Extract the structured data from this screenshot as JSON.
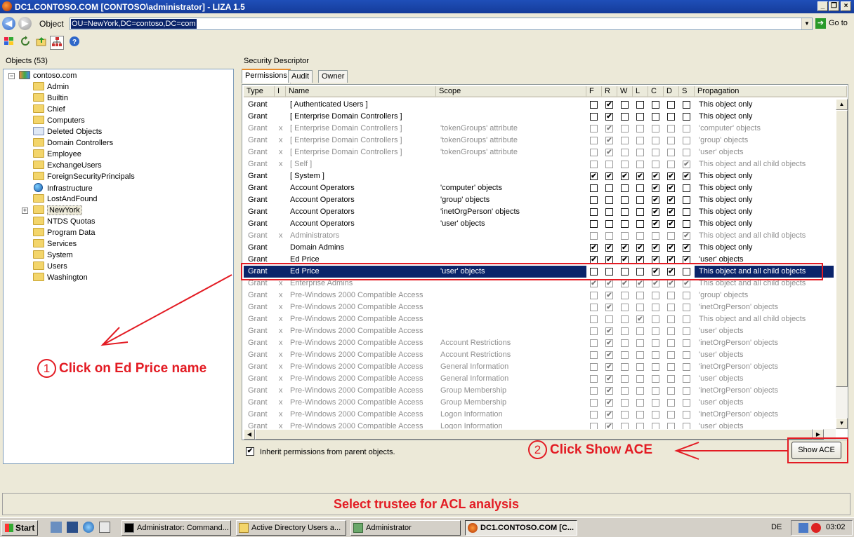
{
  "window": {
    "title": "DC1.CONTOSO.COM [CONTOSO\\administrator] - LIZA 1.5"
  },
  "address": {
    "label": "Object",
    "value": "OU=NewYork,DC=contoso,DC=com",
    "go_label": "Go to"
  },
  "toolbar": {
    "icons": [
      "windows-logo-icon",
      "refresh-icon",
      "export-icon",
      "tree-view-icon",
      "help-icon"
    ]
  },
  "objects_panel": {
    "label": "Objects (53)",
    "root": "contoso.com",
    "items": [
      "Admin",
      "Builtin",
      "Chief",
      "Computers",
      "Deleted Objects",
      "Domain Controllers",
      "Employee",
      "ExchangeUsers",
      "ForeignSecurityPrincipals",
      "Infrastructure",
      "LostAndFound",
      "NewYork",
      "NTDS Quotas",
      "Program Data",
      "Services",
      "System",
      "Users",
      "Washington"
    ],
    "selected": "NewYork"
  },
  "security": {
    "label": "Security Descriptor",
    "tabs": [
      "Permissions",
      "Audit",
      "Owner"
    ],
    "active_tab": "Permissions",
    "columns": [
      "Type",
      "I",
      "Name",
      "Scope",
      "F",
      "R",
      "W",
      "L",
      "C",
      "D",
      "S",
      "Propagation"
    ],
    "rows": [
      {
        "type": "Grant",
        "i": "",
        "name": "[ Authenticated Users ]",
        "scope": "",
        "perms": [
          0,
          1,
          0,
          0,
          0,
          0,
          0
        ],
        "prop": "This object only",
        "inherited": false
      },
      {
        "type": "Grant",
        "i": "",
        "name": "[ Enterprise Domain Controllers ]",
        "scope": "",
        "perms": [
          0,
          1,
          0,
          0,
          0,
          0,
          0
        ],
        "prop": "This object only",
        "inherited": false
      },
      {
        "type": "Grant",
        "i": "x",
        "name": "[ Enterprise Domain Controllers ]",
        "scope": "'tokenGroups' attribute",
        "perms": [
          0,
          1,
          0,
          0,
          0,
          0,
          0
        ],
        "prop": "'computer' objects",
        "inherited": true
      },
      {
        "type": "Grant",
        "i": "x",
        "name": "[ Enterprise Domain Controllers ]",
        "scope": "'tokenGroups' attribute",
        "perms": [
          0,
          1,
          0,
          0,
          0,
          0,
          0
        ],
        "prop": "'group' objects",
        "inherited": true
      },
      {
        "type": "Grant",
        "i": "x",
        "name": "[ Enterprise Domain Controllers ]",
        "scope": "'tokenGroups' attribute",
        "perms": [
          0,
          1,
          0,
          0,
          0,
          0,
          0
        ],
        "prop": "'user' objects",
        "inherited": true
      },
      {
        "type": "Grant",
        "i": "x",
        "name": "[ Self ]",
        "scope": "",
        "perms": [
          0,
          0,
          0,
          0,
          0,
          0,
          1
        ],
        "prop": "This object and all child objects",
        "inherited": true
      },
      {
        "type": "Grant",
        "i": "",
        "name": "[ System ]",
        "scope": "",
        "perms": [
          1,
          1,
          1,
          1,
          1,
          1,
          1
        ],
        "prop": "This object only",
        "inherited": false
      },
      {
        "type": "Grant",
        "i": "",
        "name": "Account Operators",
        "scope": "'computer' objects",
        "perms": [
          0,
          0,
          0,
          0,
          1,
          1,
          0
        ],
        "prop": "This object only",
        "inherited": false
      },
      {
        "type": "Grant",
        "i": "",
        "name": "Account Operators",
        "scope": "'group' objects",
        "perms": [
          0,
          0,
          0,
          0,
          1,
          1,
          0
        ],
        "prop": "This object only",
        "inherited": false
      },
      {
        "type": "Grant",
        "i": "",
        "name": "Account Operators",
        "scope": "'inetOrgPerson' objects",
        "perms": [
          0,
          0,
          0,
          0,
          1,
          1,
          0
        ],
        "prop": "This object only",
        "inherited": false
      },
      {
        "type": "Grant",
        "i": "",
        "name": "Account Operators",
        "scope": "'user' objects",
        "perms": [
          0,
          0,
          0,
          0,
          1,
          1,
          0
        ],
        "prop": "This object only",
        "inherited": false
      },
      {
        "type": "Grant",
        "i": "x",
        "name": "Administrators",
        "scope": "",
        "perms": [
          0,
          0,
          0,
          0,
          0,
          0,
          1
        ],
        "prop": "This object and all child objects",
        "inherited": true
      },
      {
        "type": "Grant",
        "i": "",
        "name": "Domain Admins",
        "scope": "",
        "perms": [
          1,
          1,
          1,
          1,
          1,
          1,
          1
        ],
        "prop": "This object only",
        "inherited": false
      },
      {
        "type": "Grant",
        "i": "",
        "name": "Ed Price",
        "scope": "",
        "perms": [
          1,
          1,
          1,
          1,
          1,
          1,
          1
        ],
        "prop": "'user' objects",
        "inherited": false
      },
      {
        "type": "Grant",
        "i": "",
        "name": "Ed Price",
        "scope": "'user' objects",
        "perms": [
          0,
          0,
          0,
          0,
          1,
          1,
          0
        ],
        "prop": "This object and all child objects",
        "inherited": false,
        "selected": true
      },
      {
        "type": "Grant",
        "i": "x",
        "name": "Enterprise Admins",
        "scope": "",
        "perms": [
          1,
          1,
          1,
          1,
          1,
          1,
          1
        ],
        "prop": "This object and all child objects",
        "inherited": true
      },
      {
        "type": "Grant",
        "i": "x",
        "name": "Pre-Windows 2000 Compatible Access",
        "scope": "",
        "perms": [
          0,
          1,
          0,
          0,
          0,
          0,
          0
        ],
        "prop": "'group' objects",
        "inherited": true
      },
      {
        "type": "Grant",
        "i": "x",
        "name": "Pre-Windows 2000 Compatible Access",
        "scope": "",
        "perms": [
          0,
          1,
          0,
          0,
          0,
          0,
          0
        ],
        "prop": "'inetOrgPerson' objects",
        "inherited": true
      },
      {
        "type": "Grant",
        "i": "x",
        "name": "Pre-Windows 2000 Compatible Access",
        "scope": "",
        "perms": [
          0,
          0,
          0,
          1,
          0,
          0,
          0
        ],
        "prop": "This object and all child objects",
        "inherited": true
      },
      {
        "type": "Grant",
        "i": "x",
        "name": "Pre-Windows 2000 Compatible Access",
        "scope": "",
        "perms": [
          0,
          1,
          0,
          0,
          0,
          0,
          0
        ],
        "prop": "'user' objects",
        "inherited": true
      },
      {
        "type": "Grant",
        "i": "x",
        "name": "Pre-Windows 2000 Compatible Access",
        "scope": "Account Restrictions",
        "perms": [
          0,
          1,
          0,
          0,
          0,
          0,
          0
        ],
        "prop": "'inetOrgPerson' objects",
        "inherited": true
      },
      {
        "type": "Grant",
        "i": "x",
        "name": "Pre-Windows 2000 Compatible Access",
        "scope": "Account Restrictions",
        "perms": [
          0,
          1,
          0,
          0,
          0,
          0,
          0
        ],
        "prop": "'user' objects",
        "inherited": true
      },
      {
        "type": "Grant",
        "i": "x",
        "name": "Pre-Windows 2000 Compatible Access",
        "scope": "General Information",
        "perms": [
          0,
          1,
          0,
          0,
          0,
          0,
          0
        ],
        "prop": "'inetOrgPerson' objects",
        "inherited": true
      },
      {
        "type": "Grant",
        "i": "x",
        "name": "Pre-Windows 2000 Compatible Access",
        "scope": "General Information",
        "perms": [
          0,
          1,
          0,
          0,
          0,
          0,
          0
        ],
        "prop": "'user' objects",
        "inherited": true
      },
      {
        "type": "Grant",
        "i": "x",
        "name": "Pre-Windows 2000 Compatible Access",
        "scope": "Group Membership",
        "perms": [
          0,
          1,
          0,
          0,
          0,
          0,
          0
        ],
        "prop": "'inetOrgPerson' objects",
        "inherited": true
      },
      {
        "type": "Grant",
        "i": "x",
        "name": "Pre-Windows 2000 Compatible Access",
        "scope": "Group Membership",
        "perms": [
          0,
          1,
          0,
          0,
          0,
          0,
          0
        ],
        "prop": "'user' objects",
        "inherited": true
      },
      {
        "type": "Grant",
        "i": "x",
        "name": "Pre-Windows 2000 Compatible Access",
        "scope": "Logon Information",
        "perms": [
          0,
          1,
          0,
          0,
          0,
          0,
          0
        ],
        "prop": "'inetOrgPerson' objects",
        "inherited": true
      },
      {
        "type": "Grant",
        "i": "x",
        "name": "Pre-Windows 2000 Compatible Access",
        "scope": "Logon Information",
        "perms": [
          0,
          1,
          0,
          0,
          0,
          0,
          0
        ],
        "prop": "'user' objects",
        "inherited": true
      }
    ],
    "inherit_label": "Inherit permissions from parent objects.",
    "inherit_checked": true,
    "show_ace_label": "Show ACE"
  },
  "annotations": {
    "step1_number": "1",
    "step1_text": "Click on Ed Price name",
    "step2_number": "2",
    "step2_text": "Click Show ACE",
    "color": "#e31b23"
  },
  "status": {
    "text": "Select trustee for ACL analysis"
  },
  "taskbar": {
    "start_label": "Start",
    "tasks": [
      "Administrator: Command...",
      "Active Directory Users a...",
      "Administrator",
      "DC1.CONTOSO.COM [C..."
    ],
    "active_task": "DC1.CONTOSO.COM [C...",
    "language": "DE",
    "clock": "03:02"
  }
}
